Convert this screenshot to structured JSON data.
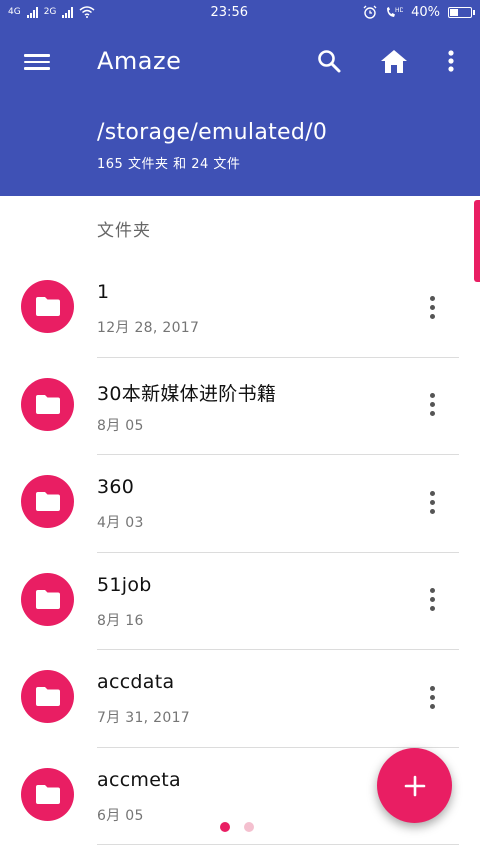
{
  "status_bar": {
    "network_1": "4G",
    "network_2": "2G",
    "time": "23:56",
    "battery_percent": "40%",
    "battery_level": 0.4
  },
  "app_bar": {
    "title": "Amaze",
    "path": "/storage/emulated/0",
    "counts": "165 文件夹 和 24 文件",
    "menu_icon": "hamburger-menu-icon",
    "search_icon": "search-icon",
    "home_icon": "home-icon",
    "more_icon": "more-vert-icon"
  },
  "section_header": "文件夹",
  "items": [
    {
      "name": "1",
      "date": "12月 28, 2017"
    },
    {
      "name": "30本新媒体进阶书籍",
      "date": "8月 05"
    },
    {
      "name": "360",
      "date": "4月 03"
    },
    {
      "name": "51job",
      "date": "8月 16"
    },
    {
      "name": "accdata",
      "date": "7月 31, 2017"
    },
    {
      "name": "accmeta",
      "date": "6月 05"
    }
  ],
  "fab_icon": "plus-icon",
  "page_indicator": {
    "count": 2,
    "active": 0
  },
  "colors": {
    "primary": "#3f51b5",
    "accent": "#e91e63",
    "indicator_inactive": "#f4c0cf"
  }
}
